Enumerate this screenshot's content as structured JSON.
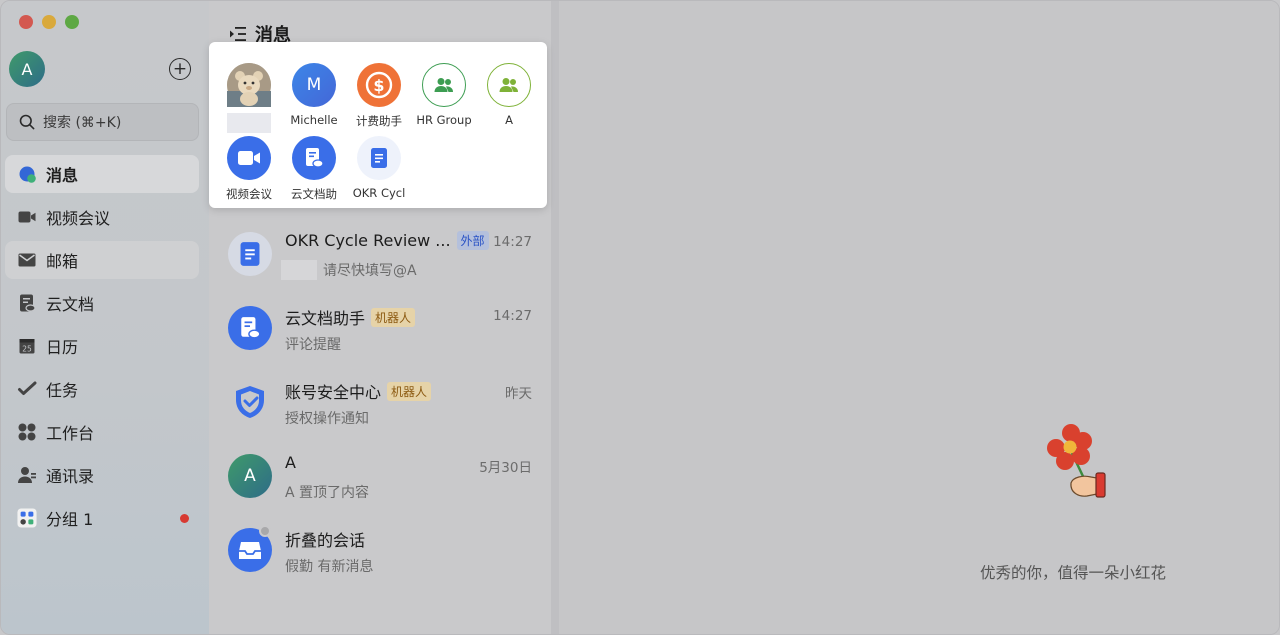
{
  "sidebar": {
    "user_initial": "A",
    "search_label": "搜索 (⌘+K)",
    "items": [
      {
        "label": "消息",
        "icon": "chat-bubble-icon"
      },
      {
        "label": "视频会议",
        "icon": "video-camera-icon"
      },
      {
        "label": "邮箱",
        "icon": "mail-icon"
      },
      {
        "label": "云文档",
        "icon": "cloud-doc-icon"
      },
      {
        "label": "日历",
        "icon": "calendar-icon",
        "calendar_day": "25"
      },
      {
        "label": "任务",
        "icon": "task-check-icon"
      },
      {
        "label": "工作台",
        "icon": "workplace-grid-icon"
      },
      {
        "label": "通讯录",
        "icon": "contacts-icon"
      },
      {
        "label": "分组 1",
        "icon": "group-icon",
        "has_unread_dot": true
      }
    ]
  },
  "middle": {
    "title": "消息",
    "pinned": [
      {
        "label": "",
        "icon": "bear-avatar-icon"
      },
      {
        "label": "Michelle",
        "initial": "M"
      },
      {
        "label": "计费助手",
        "icon": "billing-coin-icon"
      },
      {
        "label": "HR Group",
        "icon": "group-icon"
      },
      {
        "label": "A",
        "icon": "group-icon"
      },
      {
        "label": "视频会议",
        "icon": "video-camera-icon"
      },
      {
        "label": "云文档助",
        "icon": "cloud-doc-icon"
      },
      {
        "label": "OKR Cycl",
        "icon": "document-icon"
      }
    ],
    "chats": [
      {
        "title": "OKR Cycle Review ...",
        "tag": "外部",
        "time": "14:27",
        "preview": "请尽快填写@A",
        "icon": "document-icon"
      },
      {
        "title": "云文档助手",
        "tag": "机器人",
        "time": "14:27",
        "preview": "评论提醒",
        "icon": "cloud-doc-icon"
      },
      {
        "title": "账号安全中心",
        "tag": "机器人",
        "time": "昨天",
        "preview": "授权操作通知",
        "icon": "shield-icon"
      },
      {
        "title": "A",
        "tag": "",
        "time": "5月30日",
        "preview": "A 置顶了内容",
        "initial": "A"
      },
      {
        "title": "折叠的会话",
        "tag": "",
        "time": "",
        "preview": "假勤 有新消息",
        "icon": "inbox-tray-icon"
      }
    ]
  },
  "right": {
    "empty_text": "优秀的你，值得一朵小红花",
    "illustration": "red-flower-hand-icon"
  },
  "colors": {
    "accent_blue": "#3a6ee8",
    "orange": "#ee7133",
    "green": "#3aa35a",
    "red_dot": "#d73a32"
  }
}
